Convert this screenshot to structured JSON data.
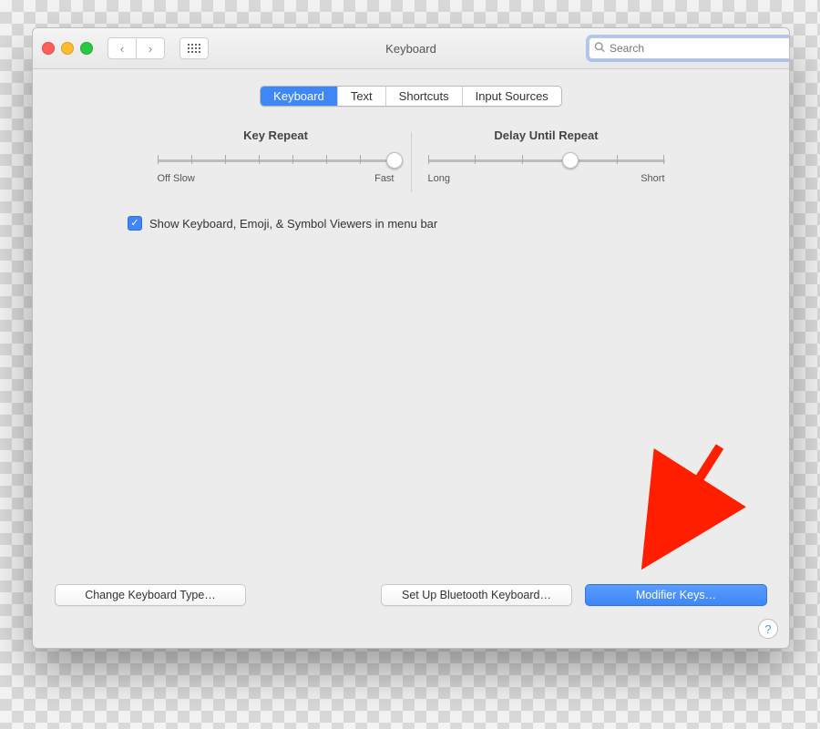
{
  "window": {
    "title": "Keyboard"
  },
  "search": {
    "placeholder": "Search"
  },
  "tabs": [
    {
      "label": "Keyboard",
      "active": true
    },
    {
      "label": "Text"
    },
    {
      "label": "Shortcuts"
    },
    {
      "label": "Input Sources"
    }
  ],
  "sliders": {
    "keyRepeat": {
      "title": "Key Repeat",
      "left": "Off Slow",
      "right": "Fast",
      "ticks": 8,
      "valueIndex": 7
    },
    "delayRepeat": {
      "title": "Delay Until Repeat",
      "left": "Long",
      "right": "Short",
      "ticks": 6,
      "valueIndex": 3
    }
  },
  "checkbox": {
    "label": "Show Keyboard, Emoji, & Symbol Viewers in menu bar",
    "checked": true
  },
  "buttons": {
    "changeType": "Change Keyboard Type…",
    "bluetooth": "Set Up Bluetooth Keyboard…",
    "modifier": "Modifier Keys…"
  },
  "help": "?",
  "colors": {
    "accent": "#3e87f5"
  }
}
